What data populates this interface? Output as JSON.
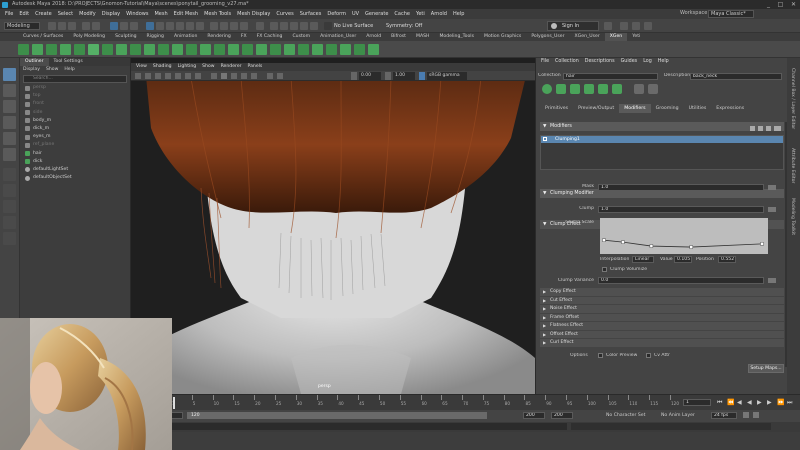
{
  "window": {
    "title": "Autodesk Maya 2018: D:\\PROJECTS\\Gnomon-Tutorial\\Maya\\scenes\\ponytail_grooming_v27.ma*",
    "buttons": [
      "_",
      "□",
      "✕"
    ]
  },
  "menubar": {
    "items": [
      "File",
      "Edit",
      "Create",
      "Select",
      "Modify",
      "Display",
      "Windows",
      "Mesh",
      "Edit Mesh",
      "Mesh Tools",
      "Mesh Display",
      "Curves",
      "Surfaces",
      "Deform",
      "UV",
      "Generate",
      "Cache",
      "Yeti",
      "Arnold",
      "Help"
    ],
    "workspace_label": "Workspace :",
    "workspace_value": "Maya Classic*"
  },
  "statusline": {
    "mode": "Modeling",
    "live_surface": "No Live Surface",
    "symmetry": "Symmetry: Off",
    "sign_in": "Sign In"
  },
  "shelf": {
    "tabs": [
      "Curves / Surfaces",
      "Poly Modeling",
      "Sculpting",
      "Rigging",
      "Animation",
      "Rendering",
      "FX",
      "FX Caching",
      "Custom",
      "Animation_User",
      "Arnold",
      "Bifrost",
      "MASH",
      "Modeling_Tools",
      "Motion Graphics",
      "Polygons_User",
      "XGen_User",
      "XGen",
      "Yeti"
    ],
    "active_tab": "XGen"
  },
  "outliner": {
    "tabs": [
      "Outliner",
      "Tool Settings"
    ],
    "menu": [
      "Display",
      "Show",
      "Help"
    ],
    "search_placeholder": "Search...",
    "items": [
      {
        "label": "persp",
        "dim": true
      },
      {
        "label": "top",
        "dim": true
      },
      {
        "label": "front",
        "dim": true
      },
      {
        "label": "side",
        "dim": true
      },
      {
        "label": "body_m",
        "dim": false
      },
      {
        "label": "dick_m",
        "dim": false
      },
      {
        "label": "eyes_m",
        "dim": false
      },
      {
        "label": "ref_plane",
        "dim": true
      },
      {
        "label": "hair",
        "dim": false
      },
      {
        "label": "dick",
        "dim": false
      },
      {
        "label": "defaultLightSet",
        "dim": false
      },
      {
        "label": "defaultObjectSet",
        "dim": false
      }
    ]
  },
  "viewport": {
    "menu": [
      "View",
      "Shading",
      "Lighting",
      "Show",
      "Renderer",
      "Panels"
    ],
    "gamma_value": "0.00",
    "gamma_scale": "1.00",
    "color_space": "sRGB gamma",
    "camera_label": "persp"
  },
  "xgen": {
    "menu": [
      "File",
      "Collection",
      "Descriptions",
      "Guides",
      "Log",
      "Help"
    ],
    "collection_label": "Collection",
    "collection_value": "hair",
    "description_label": "Description",
    "description_value": "back_neck",
    "tabs": [
      "Primitives",
      "Preview/Output",
      "Modifiers",
      "Grooming",
      "Utilities",
      "Expressions"
    ],
    "active_tab": "Modifiers",
    "modifiers_header": "Modifiers",
    "modifier_list": [
      "Clumping1"
    ],
    "clumping_header": "Clumping Modifier",
    "mask_label": "Mask",
    "mask_value": "1.0",
    "clump_effect_header": "Clump Effect",
    "clump_label": "Clump",
    "clump_value": "1.0",
    "clump_scale_label": "Clump Scale",
    "interpolation_label": "Interpolation",
    "interpolation_value": "Linear",
    "value_label": "Value",
    "value_value": "0.105",
    "position_label": "Position",
    "position_value": "0.552",
    "clump_volumize_label": "Clump Volumize",
    "clump_variance_label": "Clump Variance",
    "clump_variance_value": "0.0",
    "collapsed_sections": [
      "Copy Effect",
      "Cut Effect",
      "Noise Effect",
      "Frame Offset",
      "Flatness Effect",
      "Offset Effect",
      "Curl Effect"
    ],
    "options_label": "Options",
    "color_preview_label": "Color Preview",
    "cv_attr_label": "Cv Attr",
    "setup_maps_label": "Setup Maps...",
    "log_label": "Log",
    "clump_curve": [
      [
        0.0,
        0.35
      ],
      [
        0.12,
        0.28
      ],
      [
        0.3,
        0.14
      ],
      [
        0.552,
        0.105
      ],
      [
        1.0,
        0.22
      ]
    ]
  },
  "rightstrip": {
    "labels": [
      "Channel Box / Layer Editor",
      "Attribute Editor",
      "Modeling Toolkit"
    ]
  },
  "timeline": {
    "ticks": [
      "1",
      "5",
      "10",
      "15",
      "20",
      "25",
      "30",
      "35",
      "40",
      "45",
      "50",
      "55",
      "60",
      "65",
      "70",
      "75",
      "80",
      "85",
      "90",
      "95",
      "100",
      "105",
      "110",
      "115",
      "120"
    ],
    "current_frame": "1",
    "range_start": "1",
    "range_inner_start": "1",
    "range_inner_end": "120",
    "range_end": "200",
    "range_end2": "200",
    "character_set": "No Character Set",
    "anim_layer": "No Anim Layer",
    "fps": "24 fps"
  },
  "cmdline": {
    "lang": "MEL"
  }
}
